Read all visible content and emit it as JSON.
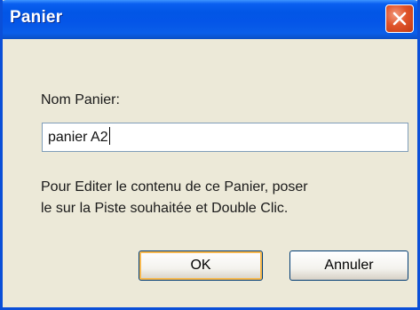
{
  "window": {
    "title": "Panier",
    "close_icon": "close-icon"
  },
  "form": {
    "name_label": "Nom Panier:",
    "name_value": "panier A2",
    "info_line1": "Pour Editer le contenu de ce Panier, poser",
    "info_line2": "le sur la Piste souhaitée et Double Clic."
  },
  "buttons": {
    "ok_label": "OK",
    "cancel_label": "Annuler"
  },
  "colors": {
    "titlebar": "#0455e8",
    "close_button": "#e0542a",
    "dialog_background": "#ece9d8",
    "default_button_focus": "#f8b94f"
  }
}
